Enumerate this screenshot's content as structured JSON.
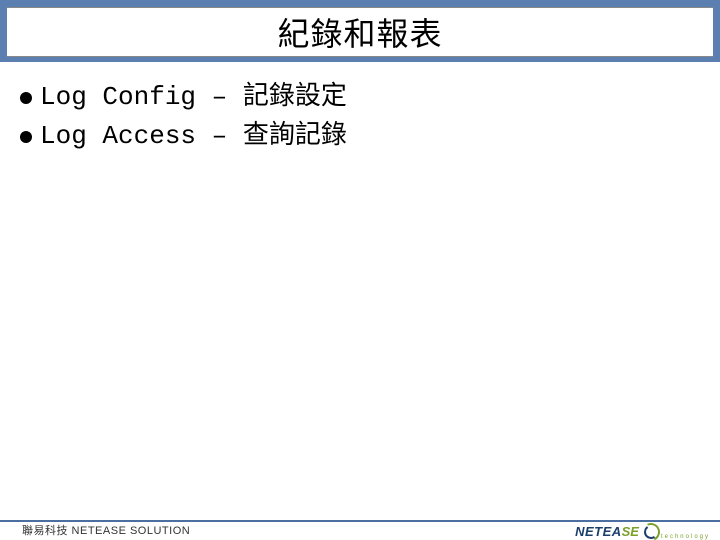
{
  "title": "紀錄和報表",
  "bullets": [
    "Log Config – 記錄設定",
    "Log Access – 查詢記錄"
  ],
  "footer": {
    "left": "聯易科技  NETEASE SOLUTION",
    "logo_main": "NETEA",
    "logo_accent": "SE",
    "logo_sub": "technology"
  }
}
